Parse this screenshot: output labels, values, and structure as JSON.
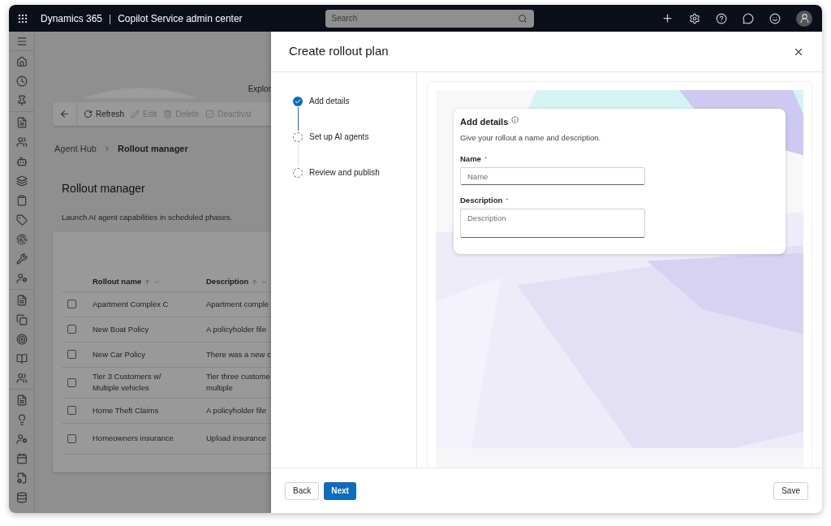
{
  "top_bar": {
    "brand": "Dynamics 365",
    "separator": "|",
    "app_name": "Copilot Service admin center",
    "search": {
      "placeholder": "Search"
    }
  },
  "background_page": {
    "hero_text": "Explor",
    "toolbar": [
      {
        "label": "Refresh",
        "disabled": false,
        "kind": "refresh"
      },
      {
        "label": "Edit",
        "disabled": true,
        "kind": "edit"
      },
      {
        "label": "Delete",
        "disabled": true,
        "kind": "delete"
      },
      {
        "label": "Deactivat",
        "disabled": true,
        "kind": "deactivate"
      }
    ],
    "breadcrumb": [
      {
        "label": "Agent Hub",
        "current": false
      },
      {
        "label": "Rollout manager",
        "current": true
      }
    ],
    "title": "Rollout manager",
    "subtitle": "Launch AI agent capabilities in scheduled phases.",
    "table": {
      "columns": [
        "Rollout name",
        "Description"
      ],
      "rows": [
        {
          "checked": false,
          "cells": [
            "Apartment Complex C",
            "Apartment comple"
          ]
        },
        {
          "checked": false,
          "cells": [
            "New Boat Policy",
            "A policyholder file"
          ]
        },
        {
          "checked": false,
          "cells": [
            "New Car Policy",
            "There was a new c"
          ]
        },
        {
          "checked": false,
          "cells": [
            "Tier 3 Customers w/ Multiple vehicles",
            "Tier three custome multiple"
          ]
        },
        {
          "checked": false,
          "cells": [
            "Home Theft Claims",
            "A policyholder file"
          ]
        },
        {
          "checked": false,
          "cells": [
            "Homeowners insurance",
            "Upload insurance"
          ]
        }
      ]
    }
  },
  "panel": {
    "title": "Create rollout plan",
    "steps": [
      {
        "label": "Add details",
        "completed": true
      },
      {
        "label": "Set up AI agents",
        "completed": false
      },
      {
        "label": "Review and publish",
        "completed": false
      }
    ],
    "form": {
      "title": "Add details",
      "subtitle": "Give your rollout a name and description.",
      "fields": [
        {
          "label": "Name",
          "required_mark": "*",
          "placeholder": "Name",
          "kind": "input"
        },
        {
          "label": "Description",
          "required_mark": "*",
          "placeholder": "Description",
          "kind": "textarea"
        }
      ]
    },
    "buttons": [
      {
        "label": "Back",
        "kind": "secondary"
      },
      {
        "label": "Next",
        "kind": "primary"
      },
      {
        "label": "Save",
        "kind": "secondary"
      }
    ]
  }
}
